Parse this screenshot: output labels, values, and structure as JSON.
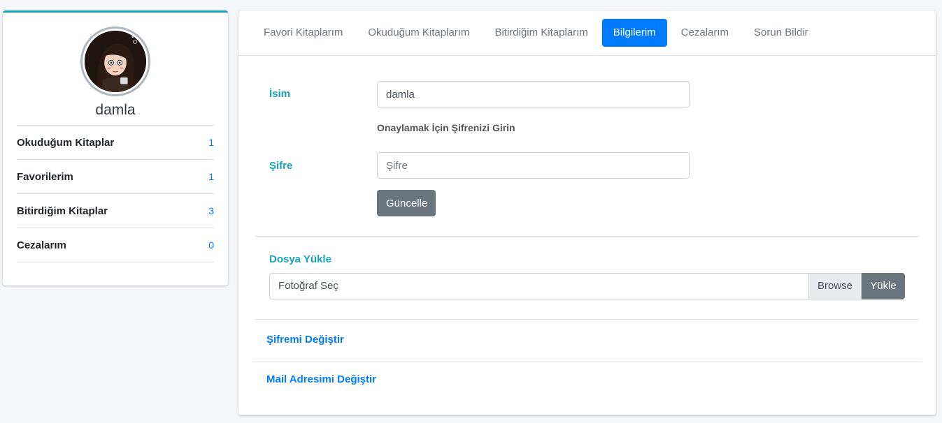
{
  "profile": {
    "name": "damla",
    "stats": [
      {
        "label": "Okuduğum Kitaplar",
        "value": "1"
      },
      {
        "label": "Favorilerim",
        "value": "1"
      },
      {
        "label": "Bitirdiğim Kitaplar",
        "value": "3"
      },
      {
        "label": "Cezalarım",
        "value": "0"
      }
    ]
  },
  "tabs": [
    {
      "label": "Favori Kitaplarım"
    },
    {
      "label": "Okuduğum Kitaplarım"
    },
    {
      "label": "Bitirdiğim Kitaplarım"
    },
    {
      "label": "Bilgilerim",
      "active": true
    },
    {
      "label": "Cezalarım"
    },
    {
      "label": "Sorun Bildir"
    }
  ],
  "form": {
    "name_label": "İsim",
    "name_value": "damla",
    "confirm_hint": "Onaylamak İçin Şifrenizi Girin",
    "password_label": "Şifre",
    "password_placeholder": "Şifre",
    "update_button": "Güncelle"
  },
  "upload": {
    "label": "Dosya Yükle",
    "file_placeholder": "Fotoğraf Seç",
    "browse_label": "Browse",
    "upload_button": "Yükle"
  },
  "links": {
    "change_password": "Şifremi Değiştir",
    "change_email": "Mail Adresimi Değiştir"
  },
  "colors": {
    "primary": "#007bff",
    "info": "#17a2b8",
    "secondary": "#6c757d"
  }
}
